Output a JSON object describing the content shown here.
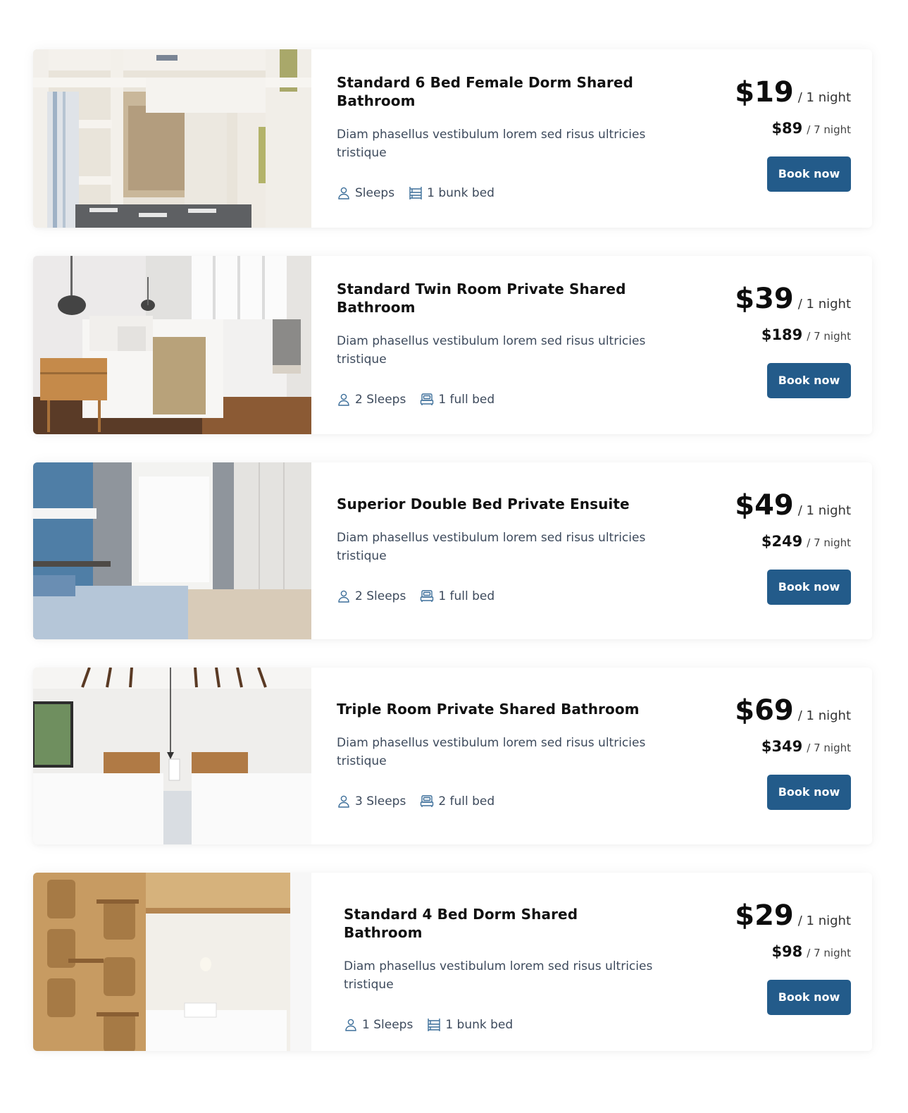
{
  "rooms": [
    {
      "title": "Standard 6 Bed Female Dorm Shared Bathroom",
      "description": "Diam phasellus vestibulum lorem sed risus ultricies tristique",
      "sleeps": "Sleeps",
      "bed": "1 bunk bed",
      "bed_icon": "bunk-bed-icon",
      "price_night": "$19",
      "price_night_unit": "/ 1 night",
      "price_week": "$89",
      "price_week_unit": "/ 7 night",
      "button": "Book now"
    },
    {
      "title": "Standard Twin Room Private Shared Bathroom",
      "description": "Diam phasellus vestibulum lorem sed risus ultricies tristique",
      "sleeps": "2 Sleeps",
      "bed": "1 full bed",
      "bed_icon": "full-bed-icon",
      "price_night": "$39",
      "price_night_unit": "/ 1 night",
      "price_week": "$189",
      "price_week_unit": "/ 7 night",
      "button": "Book now"
    },
    {
      "title": "Superior Double Bed Private Ensuite",
      "description": "Diam phasellus vestibulum lorem sed risus ultricies tristique",
      "sleeps": "2 Sleeps",
      "bed": "1 full bed",
      "bed_icon": "full-bed-icon",
      "price_night": "$49",
      "price_night_unit": "/ 1 night",
      "price_week": "$249",
      "price_week_unit": "/ 7 night",
      "button": "Book now"
    },
    {
      "title": "Triple Room Private Shared Bathroom",
      "description": "Diam phasellus vestibulum lorem sed risus ultricies tristique",
      "sleeps": "3 Sleeps",
      "bed": "2 full bed",
      "bed_icon": "full-bed-icon",
      "price_night": "$69",
      "price_night_unit": "/ 1 night",
      "price_week": "$349",
      "price_week_unit": "/ 7 night",
      "button": "Book now"
    },
    {
      "title": "Standard 4 Bed Dorm Shared Bathroom",
      "description": "Diam phasellus vestibulum lorem sed risus ultricies tristique",
      "sleeps": "1 Sleeps",
      "bed": "1 bunk bed",
      "bed_icon": "bunk-bed-icon",
      "price_night": "$29",
      "price_night_unit": "/ 1 night",
      "price_week": "$98",
      "price_week_unit": "/ 7 night",
      "button": "Book now"
    }
  ],
  "colors": {
    "button_bg": "#235b8a",
    "text_muted": "#3d4a5c",
    "icon": "#3d6f9a"
  }
}
